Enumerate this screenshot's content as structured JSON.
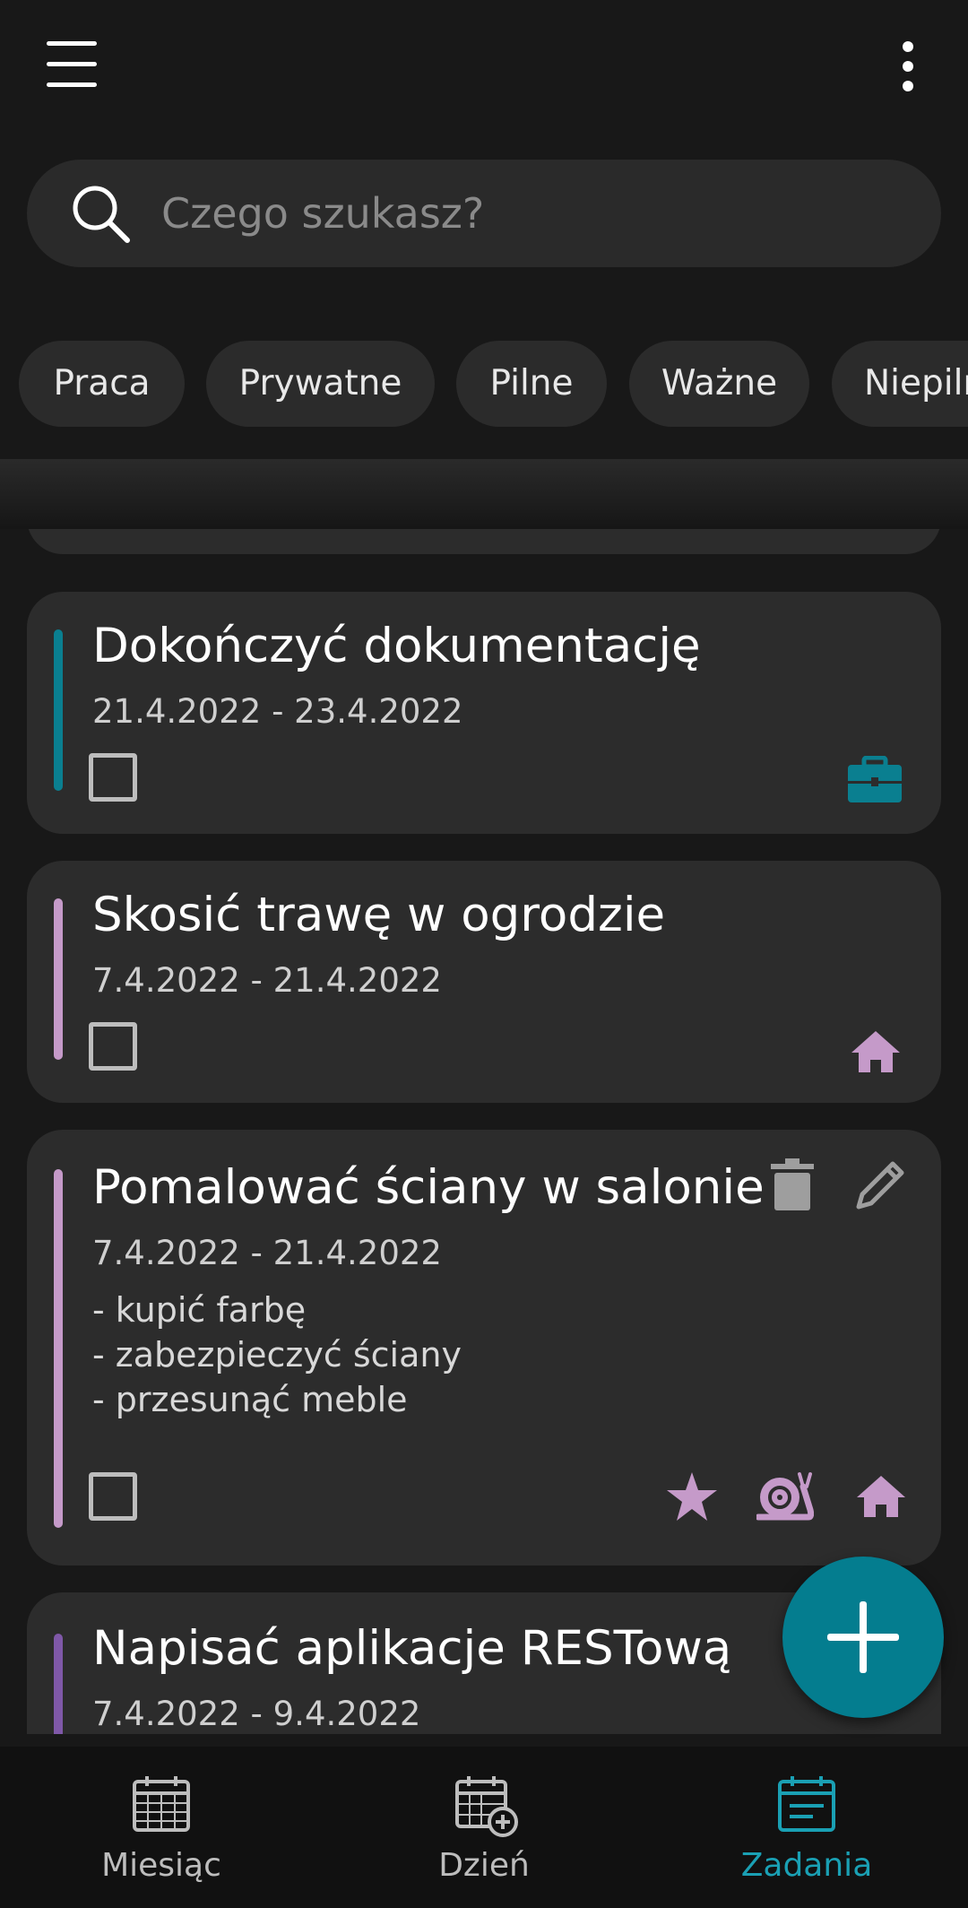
{
  "search": {
    "placeholder": "Czego szukasz?",
    "icon": "search-icon"
  },
  "toolbar": {
    "menu_icon": "hamburger-menu-icon",
    "more_icon": "more-vertical-icon"
  },
  "filters": [
    "Praca",
    "Prywatne",
    "Pilne",
    "Ważne",
    "Niepilne"
  ],
  "tasks": [
    {
      "title": "Dokończyć dokumentację",
      "dates": "21.4.2022 - 23.4.2022",
      "accent": "#0a7f90",
      "icons": [
        "briefcase-icon"
      ]
    },
    {
      "title": "Skosić trawę w ogrodzie",
      "dates": "7.4.2022 - 21.4.2022",
      "accent": "#c59ac9",
      "icons": [
        "home-icon"
      ]
    },
    {
      "title": "Pomalować ściany w salonie",
      "dates": "7.4.2022 - 21.4.2022",
      "accent": "#c59ac9",
      "notes": [
        "- kupić farbę",
        "- zabezpieczyć ściany",
        "- przesunąć meble"
      ],
      "icons": [
        "star-icon",
        "snail-icon",
        "home-icon"
      ]
    },
    {
      "title": "Napisać aplikacje RESTową",
      "dates": "7.4.2022 - 9.4.2022",
      "accent": "#7f58a8"
    }
  ],
  "nav": {
    "month": "Miesiąc",
    "day": "Dzień",
    "tasks": "Zadania",
    "active": "tasks",
    "active_color": "#1aa0b4"
  },
  "colors": {
    "background": "#181818",
    "card": "#2c2c2c",
    "fab": "#047d8f",
    "work": "#0a7f90",
    "private": "#c59ac9"
  }
}
